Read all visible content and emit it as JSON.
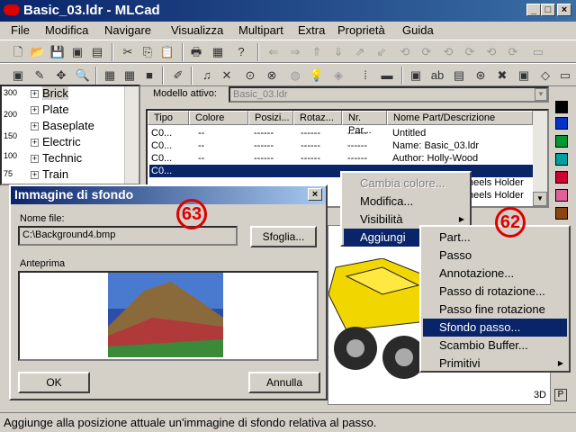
{
  "window": {
    "title": "Basic_03.ldr - MLCad"
  },
  "menu": [
    "File",
    "Modifica",
    "Navigare",
    "Visualizza",
    "Multipart",
    "Extra",
    "Proprietà",
    "Guida"
  ],
  "tree": {
    "zoom_labels": [
      "300",
      "200",
      "150",
      "100",
      "75"
    ],
    "items": [
      "Brick",
      "Plate",
      "Baseplate",
      "Electric",
      "Technic",
      "Train"
    ]
  },
  "model": {
    "label": "Modello attivo:",
    "value": "Basic_03.ldr"
  },
  "table": {
    "headers": [
      "Tipo",
      "Colore",
      "Posizi...",
      "Rotaz...",
      "Nr. Par...",
      "Nome Part/Descrizione"
    ],
    "rows": [
      {
        "type": "C0...",
        "color": "--",
        "pos": "------",
        "rot": "------",
        "nr": "------",
        "name": "Untitled"
      },
      {
        "type": "C0...",
        "color": "--",
        "pos": "------",
        "rot": "------",
        "nr": "------",
        "name": "Name: Basic_03.ldr"
      },
      {
        "type": "C0...",
        "color": "--",
        "pos": "------",
        "rot": "------",
        "nr": "------",
        "name": "Author: Holly-Wood"
      },
      {
        "type": "C0...",
        "color": "",
        "pos": "",
        "rot": "",
        "nr": "",
        "name": ""
      }
    ],
    "partial_names": [
      "heels Holder",
      "heels Holder"
    ]
  },
  "palette": [
    "#000000",
    "#0033cc",
    "#009933",
    "#00a0a0",
    "#cc0033",
    "#e0609a",
    "#8b4513"
  ],
  "dialog": {
    "title": "Immagine di sfondo",
    "file_label": "Nome file:",
    "file_value": "C:\\Background4.bmp",
    "browse": "Sfoglia...",
    "preview_label": "Anteprima",
    "ok": "OK",
    "cancel": "Annulla",
    "badge": "63"
  },
  "ctx_menu": [
    "Cambia colore...",
    "Modifica...",
    "Visibilità",
    "Aggiungi"
  ],
  "sub_menu": [
    "Part...",
    "Passo",
    "Annotazione...",
    "Passo di rotazione...",
    "Passo fine rotazione",
    "Sfondo passo...",
    "Scambio Buffer...",
    "Primitivi"
  ],
  "badge2": "62",
  "viewport": {
    "label": "3D"
  },
  "status": "Aggiunge alla posizione attuale un'immagine di sfondo relativa al passo."
}
